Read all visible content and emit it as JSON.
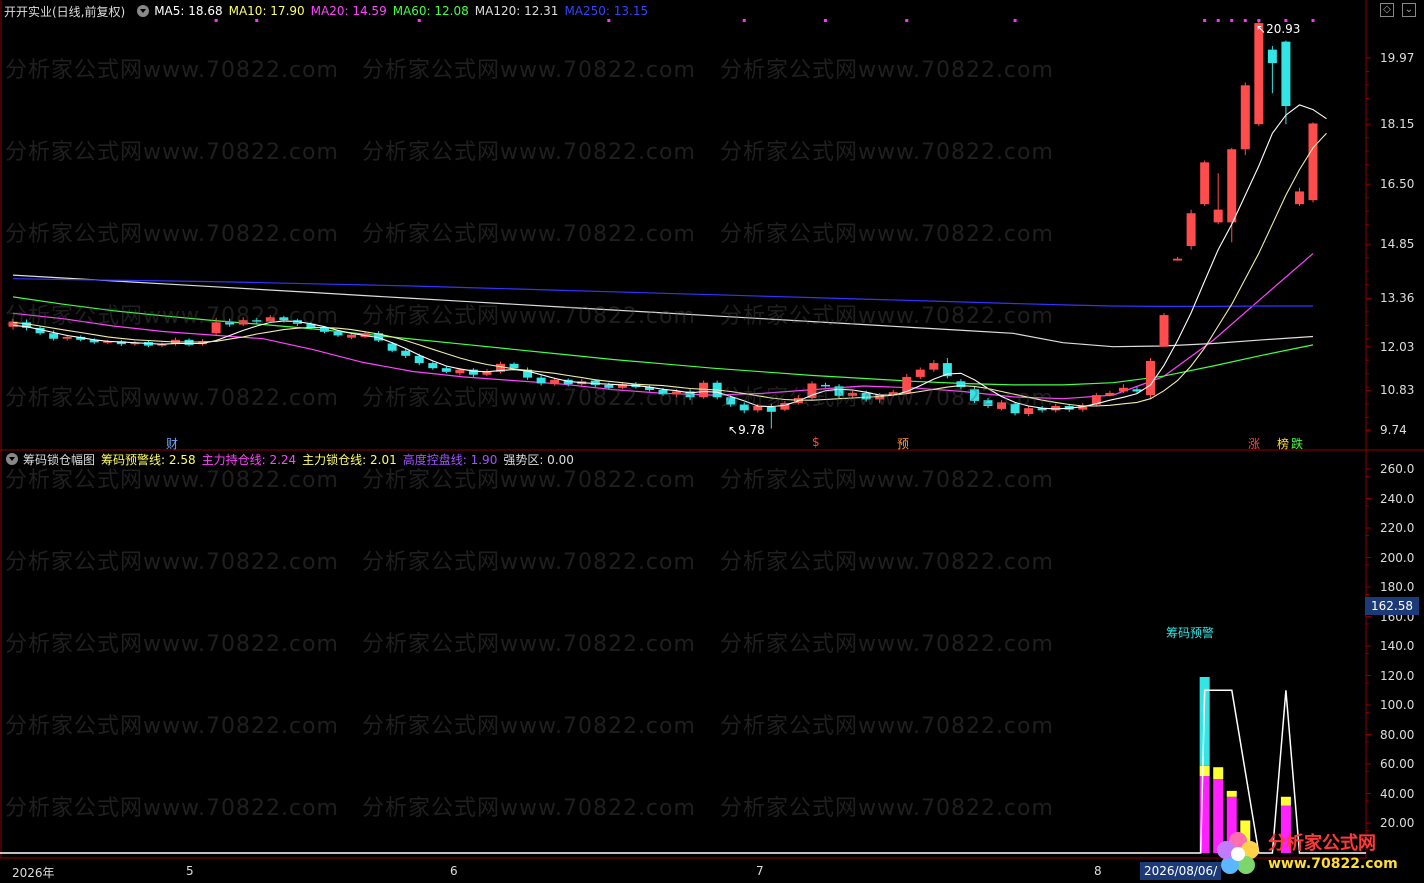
{
  "main_header": {
    "title": "开开实业(日线,前复权)",
    "ma5": "MA5: 18.68",
    "ma10": "MA10: 17.90",
    "ma20": "MA20: 14.59",
    "ma60": "MA60: 12.08",
    "ma120": "MA120: 12.31",
    "ma250": "MA250: 13.15"
  },
  "sub_header": {
    "title": "筹码锁仓幅图",
    "warn_line": "筹码预警线: 2.58",
    "hold_line": "主力持仓线: 2.24",
    "lock_line": "主力锁仓线: 2.01",
    "ctrl_line": "高度控盘线: 1.90",
    "strong_zone": "强势区: 0.00"
  },
  "right_axis_main": [
    "19.97",
    "18.15",
    "16.50",
    "14.85",
    "13.36",
    "12.03",
    "10.83",
    "9.74"
  ],
  "right_axis_sub": [
    "260.0",
    "240.0",
    "220.0",
    "200.0",
    "180.0",
    "160.0",
    "140.0",
    "120.0",
    "100.0",
    "80.00",
    "60.00",
    "40.00",
    "20.00"
  ],
  "crosshair_value": "162.58",
  "x_axis": {
    "year": "2026年",
    "months": [
      "5",
      "6",
      "7",
      "8"
    ],
    "current_date": "2026/08/06/"
  },
  "annotations": {
    "high": "20.93",
    "low": "9.78",
    "cai": "财",
    "dollar": "$",
    "yu": "预",
    "zhang": "涨",
    "bang": "榜",
    "die": "跌",
    "chip_warning": "筹码预警"
  },
  "watermark": "分析家公式网www.70822.com",
  "logo": {
    "name": "分析家公式网",
    "url": "www.70822.com"
  },
  "colors": {
    "up": "#ff4d4d",
    "down": "#33e5e5",
    "ma5": "#ffffff",
    "ma10": "#ffff66",
    "ma20": "#ff44ff",
    "ma60": "#44ff44",
    "ma120": "#dddddd",
    "ma250": "#3333ff",
    "grid": "#8b0000"
  },
  "candles": [
    [
      "up",
      12.58,
      12.72,
      12.8,
      12.5
    ],
    [
      "down",
      12.7,
      12.55,
      12.78,
      12.48
    ],
    [
      "down",
      12.55,
      12.4,
      12.6,
      12.35
    ],
    [
      "down",
      12.4,
      12.25,
      12.48,
      12.2
    ],
    [
      "up",
      12.25,
      12.3,
      12.36,
      12.2
    ],
    [
      "down",
      12.3,
      12.22,
      12.34,
      12.18
    ],
    [
      "down",
      12.22,
      12.15,
      12.26,
      12.1
    ],
    [
      "up",
      12.15,
      12.18,
      12.22,
      12.1
    ],
    [
      "down",
      12.18,
      12.1,
      12.22,
      12.05
    ],
    [
      "up",
      12.1,
      12.14,
      12.18,
      12.06
    ],
    [
      "down",
      12.16,
      12.06,
      12.2,
      12.02
    ],
    [
      "up",
      12.06,
      12.1,
      12.14,
      12.02
    ],
    [
      "up",
      12.1,
      12.22,
      12.28,
      12.06
    ],
    [
      "down",
      12.22,
      12.08,
      12.26,
      12.04
    ],
    [
      "up",
      12.1,
      12.18,
      12.24,
      12.06
    ],
    [
      "up",
      12.4,
      12.7,
      12.82,
      12.36
    ],
    [
      "down",
      12.72,
      12.64,
      12.8,
      12.58
    ],
    [
      "up",
      12.64,
      12.76,
      12.84,
      12.6
    ],
    [
      "down",
      12.76,
      12.72,
      12.82,
      12.66
    ],
    [
      "up",
      12.72,
      12.84,
      12.9,
      12.68
    ],
    [
      "down",
      12.84,
      12.76,
      12.88,
      12.7
    ],
    [
      "down",
      12.76,
      12.66,
      12.8,
      12.6
    ],
    [
      "down",
      12.66,
      12.55,
      12.7,
      12.5
    ],
    [
      "down",
      12.55,
      12.44,
      12.6,
      12.4
    ],
    [
      "down",
      12.44,
      12.34,
      12.48,
      12.3
    ],
    [
      "up",
      12.28,
      12.36,
      12.4,
      12.24
    ],
    [
      "up",
      12.3,
      12.4,
      12.46,
      12.26
    ],
    [
      "down",
      12.4,
      12.2,
      12.46,
      12.16
    ],
    [
      "down",
      12.12,
      11.92,
      12.16,
      11.88
    ],
    [
      "down",
      11.92,
      11.78,
      11.98,
      11.72
    ],
    [
      "down",
      11.78,
      11.58,
      11.84,
      11.52
    ],
    [
      "down",
      11.58,
      11.44,
      11.62,
      11.4
    ],
    [
      "down",
      11.44,
      11.34,
      11.5,
      11.3
    ],
    [
      "up",
      11.3,
      11.4,
      11.44,
      11.24
    ],
    [
      "down",
      11.4,
      11.26,
      11.44,
      11.2
    ],
    [
      "up",
      11.26,
      11.36,
      11.42,
      11.22
    ],
    [
      "up",
      11.34,
      11.56,
      11.62,
      11.3
    ],
    [
      "down",
      11.56,
      11.44,
      11.6,
      11.38
    ],
    [
      "down",
      11.4,
      11.18,
      11.46,
      11.12
    ],
    [
      "down",
      11.18,
      11.02,
      11.24,
      10.96
    ],
    [
      "up",
      11.0,
      11.12,
      11.18,
      10.96
    ],
    [
      "down",
      11.12,
      11.0,
      11.16,
      10.94
    ],
    [
      "up",
      11.0,
      11.08,
      11.14,
      10.96
    ],
    [
      "down",
      11.1,
      10.98,
      11.14,
      10.92
    ],
    [
      "down",
      10.98,
      10.9,
      11.04,
      10.86
    ],
    [
      "up",
      10.9,
      11.0,
      11.06,
      10.86
    ],
    [
      "down",
      11.0,
      10.92,
      11.06,
      10.88
    ],
    [
      "down",
      10.92,
      10.84,
      10.96,
      10.8
    ],
    [
      "down",
      10.84,
      10.72,
      10.9,
      10.68
    ],
    [
      "up",
      10.72,
      10.8,
      10.86,
      10.64
    ],
    [
      "down",
      10.8,
      10.64,
      10.86,
      10.56
    ],
    [
      "up",
      10.64,
      11.04,
      11.1,
      10.6
    ],
    [
      "down",
      11.04,
      10.64,
      11.1,
      10.58
    ],
    [
      "down",
      10.64,
      10.44,
      10.7,
      10.38
    ],
    [
      "down",
      10.44,
      10.28,
      10.5,
      10.2
    ],
    [
      "up",
      10.28,
      10.4,
      10.46,
      10.22
    ],
    [
      "down",
      10.4,
      10.24,
      10.46,
      9.78
    ],
    [
      "up",
      10.3,
      10.48,
      10.54,
      10.26
    ],
    [
      "up",
      10.48,
      10.62,
      10.7,
      10.44
    ],
    [
      "up",
      10.62,
      11.02,
      11.08,
      10.58
    ],
    [
      "down",
      10.98,
      10.94,
      11.04,
      10.9
    ],
    [
      "down",
      10.94,
      10.68,
      11.0,
      10.62
    ],
    [
      "up",
      10.68,
      10.76,
      10.82,
      10.64
    ],
    [
      "down",
      10.76,
      10.58,
      10.82,
      10.52
    ],
    [
      "up",
      10.58,
      10.7,
      10.76,
      10.48
    ],
    [
      "up",
      10.7,
      10.78,
      10.84,
      10.66
    ],
    [
      "up",
      10.76,
      11.2,
      11.28,
      10.72
    ],
    [
      "up",
      11.2,
      11.4,
      11.46,
      11.14
    ],
    [
      "up",
      11.4,
      11.58,
      11.66,
      11.34
    ],
    [
      "down",
      11.58,
      11.22,
      11.72,
      11.16
    ],
    [
      "down",
      11.08,
      10.92,
      11.14,
      10.86
    ],
    [
      "down",
      10.86,
      10.54,
      10.92,
      10.48
    ],
    [
      "down",
      10.56,
      10.4,
      10.62,
      10.34
    ],
    [
      "up",
      10.32,
      10.5,
      10.56,
      10.28
    ],
    [
      "down",
      10.46,
      10.2,
      10.5,
      10.14
    ],
    [
      "up",
      10.18,
      10.34,
      10.4,
      10.12
    ],
    [
      "down",
      10.34,
      10.28,
      10.4,
      10.22
    ],
    [
      "up",
      10.28,
      10.4,
      10.46,
      10.22
    ],
    [
      "down",
      10.4,
      10.3,
      10.46,
      10.24
    ],
    [
      "up",
      10.3,
      10.42,
      10.48,
      10.24
    ],
    [
      "up",
      10.44,
      10.7,
      10.76,
      10.4
    ],
    [
      "up",
      10.7,
      10.76,
      10.82,
      10.66
    ],
    [
      "up",
      10.8,
      10.9,
      11.0,
      10.76
    ],
    [
      "down",
      10.86,
      10.8,
      10.92,
      10.76
    ],
    [
      "up",
      10.7,
      11.64,
      11.72,
      10.62
    ],
    [
      "up",
      12.03,
      12.9,
      12.96,
      12.03
    ],
    [
      "up",
      14.4,
      14.45,
      14.5,
      14.4
    ],
    [
      "up",
      14.8,
      15.7,
      15.8,
      14.7
    ],
    [
      "up",
      15.95,
      17.1,
      17.15,
      15.9
    ],
    [
      "up",
      15.45,
      15.8,
      16.8,
      15.4
    ],
    [
      "up",
      15.45,
      17.46,
      17.5,
      14.9
    ],
    [
      "up",
      17.46,
      19.22,
      19.3,
      17.3
    ],
    [
      "up",
      18.15,
      20.93,
      20.98,
      18.1
    ],
    [
      "down",
      20.2,
      19.83,
      20.3,
      19.0
    ],
    [
      "down",
      20.42,
      18.65,
      20.45,
      18.15
    ],
    [
      "up",
      15.95,
      16.3,
      16.4,
      15.9
    ],
    [
      "up",
      16.06,
      18.17,
      18.2,
      16.0
    ]
  ],
  "ma_series": {
    "ma5": [
      12.62,
      12.58,
      12.5,
      12.42,
      12.34,
      12.28,
      12.22,
      12.18,
      12.16,
      12.14,
      12.12,
      12.1,
      12.12,
      12.12,
      12.12,
      12.2,
      12.34,
      12.48,
      12.6,
      12.7,
      12.74,
      12.72,
      12.66,
      12.58,
      12.48,
      12.4,
      12.34,
      12.28,
      12.14,
      11.98,
      11.8,
      11.64,
      11.5,
      11.42,
      11.36,
      11.34,
      11.38,
      11.4,
      11.36,
      11.26,
      11.16,
      11.08,
      11.04,
      11.02,
      11.0,
      10.98,
      10.96,
      10.92,
      10.86,
      10.82,
      10.76,
      10.8,
      10.78,
      10.66,
      10.54,
      10.4,
      10.38,
      10.42,
      10.54,
      10.7,
      10.82,
      10.86,
      10.84,
      10.78,
      10.7,
      10.7,
      10.8,
      10.96,
      11.14,
      11.28,
      11.3,
      11.12,
      10.88,
      10.66,
      10.5,
      10.4,
      10.34,
      10.32,
      10.34,
      10.38,
      10.46,
      10.56,
      10.64,
      10.74,
      10.98,
      11.52,
      12.2,
      12.96,
      13.84,
      14.7,
      15.4,
      16.2,
      17.0,
      17.9,
      18.4,
      18.68,
      18.55,
      18.3
    ],
    "ma10": [
      12.7,
      12.66,
      12.6,
      12.54,
      12.48,
      12.42,
      12.36,
      12.3,
      12.26,
      12.22,
      12.2,
      12.18,
      12.16,
      12.16,
      12.16,
      12.18,
      12.24,
      12.3,
      12.38,
      12.44,
      12.5,
      12.54,
      12.56,
      12.56,
      12.54,
      12.5,
      12.44,
      12.38,
      12.3,
      12.2,
      12.08,
      11.96,
      11.84,
      11.72,
      11.62,
      11.54,
      11.48,
      11.42,
      11.38,
      11.34,
      11.3,
      11.24,
      11.18,
      11.12,
      11.08,
      11.04,
      11.0,
      10.98,
      10.96,
      10.92,
      10.88,
      10.86,
      10.84,
      10.8,
      10.74,
      10.68,
      10.62,
      10.58,
      10.56,
      10.56,
      10.58,
      10.6,
      10.62,
      10.64,
      10.66,
      10.7,
      10.74,
      10.8,
      10.86,
      10.92,
      10.96,
      10.94,
      10.88,
      10.8,
      10.72,
      10.64,
      10.56,
      10.5,
      10.44,
      10.4,
      10.4,
      10.42,
      10.46,
      10.5,
      10.6,
      10.82,
      11.1,
      11.5,
      12.0,
      12.6,
      13.2,
      13.9,
      14.6,
      15.4,
      16.2,
      16.9,
      17.5,
      17.9
    ]
  },
  "long_ma": {
    "ma20": [
      12.95,
      12.8,
      12.6,
      12.45,
      12.35,
      12.25,
      11.95,
      11.6,
      11.35,
      11.2,
      11.1,
      11.0,
      10.85,
      10.75,
      10.7,
      10.75,
      10.85,
      10.95,
      10.9,
      10.8,
      10.65,
      10.6,
      10.7,
      11.2,
      12.2,
      13.4,
      14.59
    ],
    "ma60": [
      13.4,
      13.2,
      13.02,
      12.88,
      12.75,
      12.64,
      12.52,
      12.38,
      12.24,
      12.1,
      11.96,
      11.82,
      11.68,
      11.56,
      11.44,
      11.34,
      11.24,
      11.16,
      11.08,
      11.02,
      10.98,
      10.98,
      11.04,
      11.22,
      11.5,
      11.8,
      12.08
    ],
    "ma120": [
      14.0,
      13.92,
      13.84,
      13.76,
      13.68,
      13.6,
      13.52,
      13.44,
      13.36,
      13.28,
      13.2,
      13.12,
      13.04,
      12.96,
      12.88,
      12.8,
      12.72,
      12.64,
      12.56,
      12.48,
      12.4,
      12.14,
      12.03,
      12.05,
      12.12,
      12.22,
      12.31
    ],
    "ma250": [
      13.9,
      13.88,
      13.86,
      13.84,
      13.82,
      13.79,
      13.76,
      13.73,
      13.7,
      13.66,
      13.62,
      13.58,
      13.54,
      13.5,
      13.46,
      13.42,
      13.38,
      13.34,
      13.3,
      13.26,
      13.22,
      13.18,
      13.15,
      13.14,
      13.14,
      13.15,
      13.15
    ]
  },
  "sub_bars": [
    {
      "idx": 0,
      "m": 52,
      "y": 7,
      "c": 60
    },
    {
      "idx": 1,
      "m": 50,
      "y": 8
    },
    {
      "idx": 2,
      "m": 38,
      "y": 4
    },
    {
      "idx": 3,
      "m": 0,
      "y": 22
    },
    {
      "idx": 6,
      "m": 32,
      "y": 6
    }
  ]
}
